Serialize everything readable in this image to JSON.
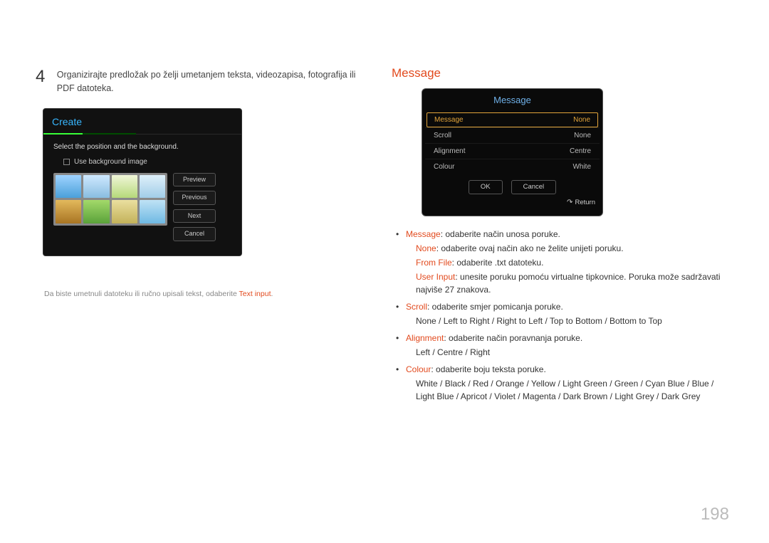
{
  "page_number": "198",
  "left": {
    "step_number": "4",
    "step_text": "Organizirajte predložak po želji umetanjem teksta, videozapisa, fotografija ili PDF datoteka.",
    "create": {
      "title": "Create",
      "subtitle": "Select the position and the background.",
      "checkbox_label": "Use background image",
      "buttons": {
        "preview": "Preview",
        "previous": "Previous",
        "next": "Next",
        "cancel": "Cancel"
      }
    },
    "note_prefix": "Da biste umetnuli datoteku ili ručno upisali tekst, odaberite ",
    "note_emph": "Text input",
    "note_suffix": "."
  },
  "right": {
    "heading": "Message",
    "panel": {
      "title": "Message",
      "rows": {
        "message": "Message",
        "message_val": "None",
        "scroll": "Scroll",
        "scroll_val": "None",
        "alignment": "Alignment",
        "alignment_val": "Centre",
        "colour": "Colour",
        "colour_val": "White"
      },
      "ok": "OK",
      "cancel": "Cancel",
      "return": "Return"
    },
    "bullets": {
      "message_label": "Message",
      "message_text": ": odaberite način unosa poruke.",
      "none_label": "None",
      "none_text": ": odaberite ovaj način ako ne želite unijeti poruku.",
      "fromfile_label": "From File",
      "fromfile_text": ": odaberite .txt datoteku.",
      "userinput_label": "User Input",
      "userinput_text": ": unesite poruku pomoću virtualne tipkovnice. Poruka može sadržavati najviše 27 znakova.",
      "scroll_label": "Scroll",
      "scroll_text": ": odaberite smjer pomicanja poruke.",
      "scroll_opts": [
        "None",
        "Left to Right",
        "Right to Left",
        "Top to Bottom",
        "Bottom to Top"
      ],
      "alignment_label": "Alignment",
      "alignment_text": ": odaberite način poravnanja poruke.",
      "alignment_opts": [
        "Left",
        "Centre",
        "Right"
      ],
      "colour_label": "Colour",
      "colour_text": ": odaberite boju teksta poruke.",
      "colour_opts": [
        "White",
        "Black",
        "Red",
        "Orange",
        "Yellow",
        "Light Green",
        "Green",
        "Cyan Blue",
        "Blue",
        "Light Blue",
        "Apricot",
        "Violet",
        "Magenta",
        "Dark Brown",
        "Light Grey",
        "Dark Grey"
      ]
    }
  }
}
